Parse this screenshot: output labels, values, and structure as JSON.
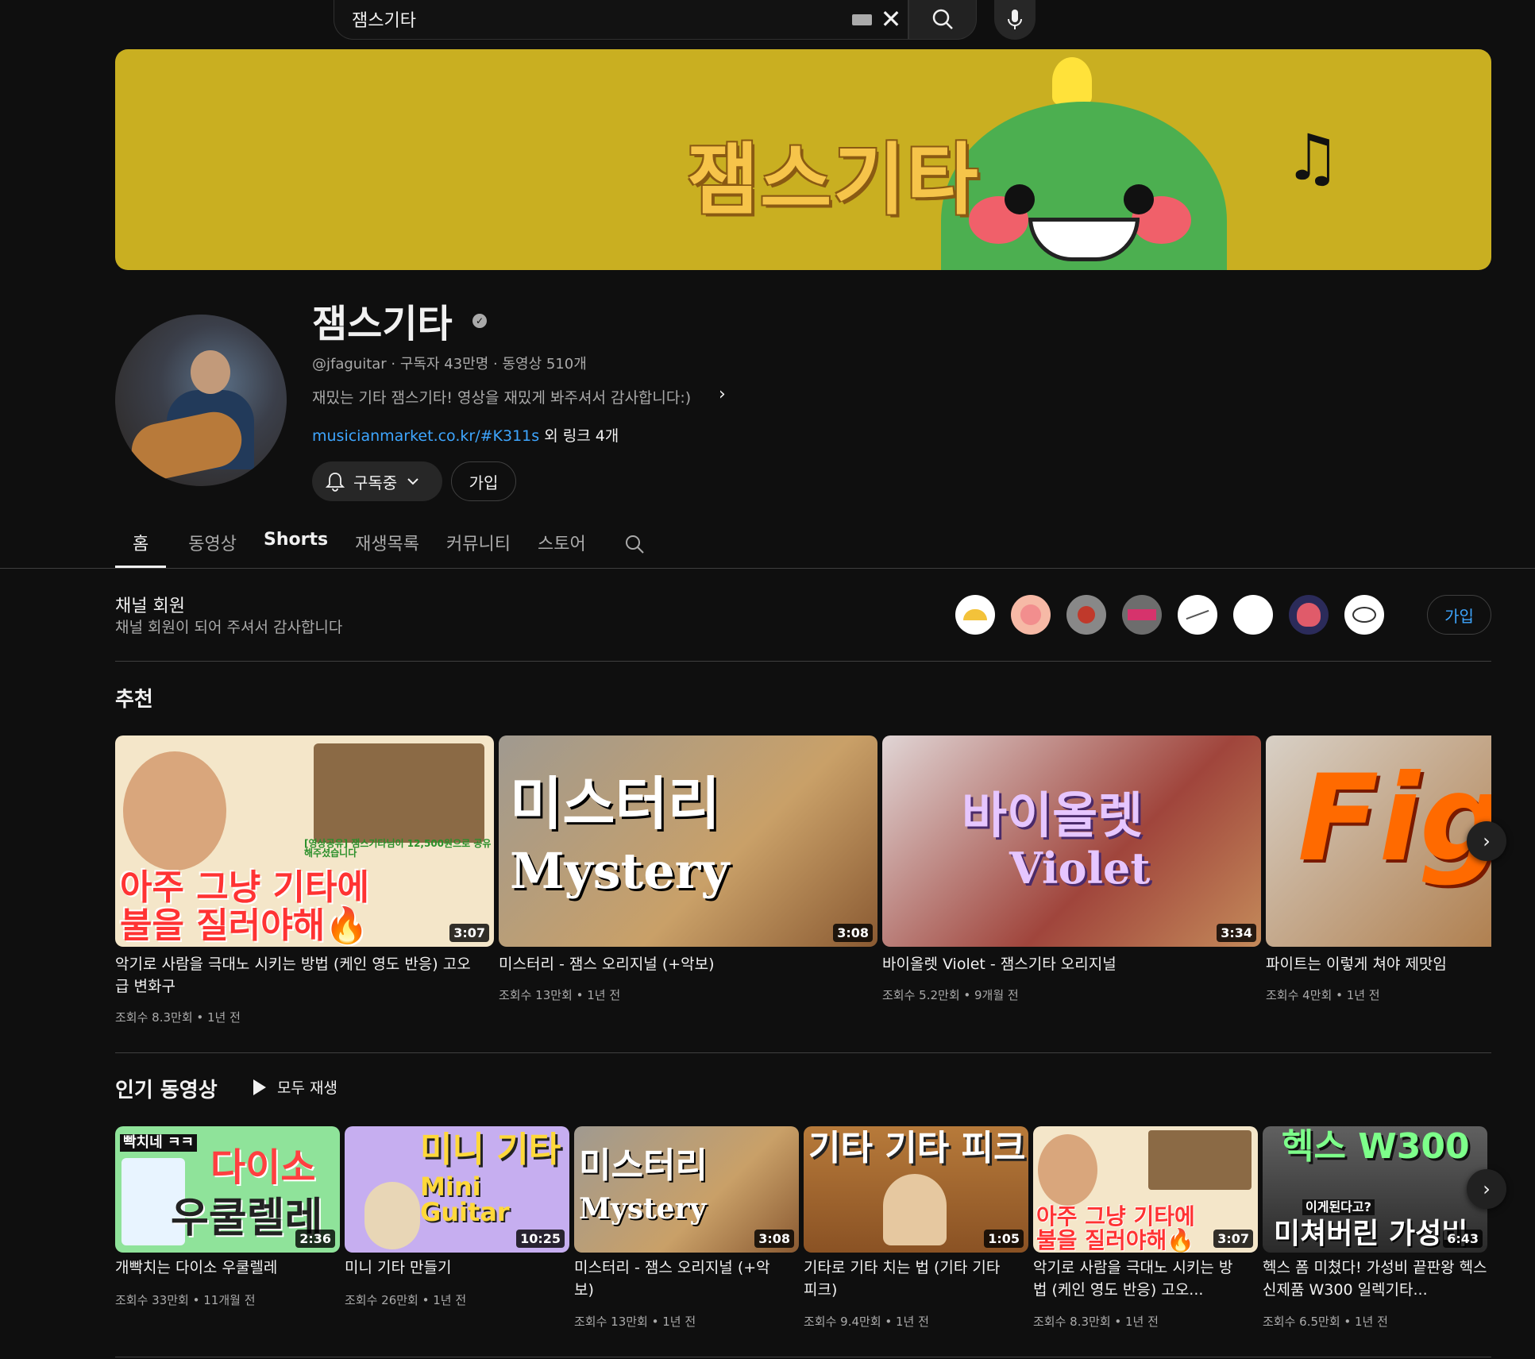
{
  "search": {
    "value": "잼스기타"
  },
  "banner": {
    "title": "잼스기타"
  },
  "channel": {
    "name": "잼스기타",
    "handle_stats": "@jfaguitar · 구독자 43만명 · 동영상 510개",
    "description": "재밌는 기타 잼스기타! 영상을 재밌게 봐주셔서 감사합니다:)",
    "link": "musicianmarket.co.kr/#K311s",
    "link_suffix": " 외 링크 4개",
    "subscribed_label": "구독중",
    "join_label": "가입"
  },
  "tabs": [
    {
      "label": "홈"
    },
    {
      "label": "동영상"
    },
    {
      "label": "Shorts"
    },
    {
      "label": "재생목록"
    },
    {
      "label": "커뮤니티"
    },
    {
      "label": "스토어"
    }
  ],
  "members": {
    "title": "채널 회원",
    "subtitle": "채널 회원이 되어 주셔서 감사합니다",
    "join_label": "가입"
  },
  "recommended": {
    "title": "추천",
    "videos": [
      {
        "thumb_line1": "아주 그냥 기타에",
        "thumb_line2": "불을 질러야해🔥",
        "thumb_note": "[영상공유] 잼스기타님이 12,500원으로 공유 해주셨습니다",
        "duration": "3:07",
        "title": "악기로 사람을 극대노 시키는 방법 (케인 영도 반응) 고오급 변화구",
        "meta": "조회수 8.3만회 • 1년 전"
      },
      {
        "thumb_line1": "미스터리",
        "thumb_line2": "Mystery",
        "duration": "3:08",
        "title": "미스터리 - 잼스 오리지널 (+악보)",
        "meta": "조회수 13만회 • 1년 전"
      },
      {
        "thumb_line1": "바이올렛",
        "thumb_line2": "Violet",
        "duration": "3:34",
        "title": "바이올렛 Violet - 잼스기타 오리지널",
        "meta": "조회수 5.2만회 • 9개월 전"
      },
      {
        "thumb_line1": "Fig",
        "duration": "",
        "title": "파이트는 이렇게 쳐야 제맛임",
        "meta": "조회수 4만회 • 1년 전"
      }
    ]
  },
  "popular": {
    "title": "인기 동영상",
    "play_all": "모두 재생",
    "videos": [
      {
        "thumb_line1": "빡치네 ㅋㅋ",
        "thumb_line2": "다이소",
        "thumb_line3": "우쿨렐레",
        "duration": "2:36",
        "title": "개빡치는 다이소 우쿨렐레",
        "meta": "조회수 33만회 • 11개월 전"
      },
      {
        "thumb_line1": "미니 기타",
        "thumb_line2": "Mini Guitar",
        "duration": "10:25",
        "title": "미니 기타 만들기",
        "meta": "조회수 26만회 • 1년 전"
      },
      {
        "thumb_line1": "미스터리",
        "thumb_line2": "Mystery",
        "duration": "3:08",
        "title": "미스터리 - 잼스 오리지널 (+악보)",
        "meta": "조회수 13만회 • 1년 전"
      },
      {
        "thumb_line1": "기타 기타 피크",
        "duration": "1:05",
        "title": "기타로 기타 치는 법 (기타 기타 피크)",
        "meta": "조회수 9.4만회 • 1년 전"
      },
      {
        "thumb_line1": "아주 그냥 기타에",
        "thumb_line2": "불을 질러야해🔥",
        "duration": "3:07",
        "title": "악기로 사람을 극대노 시키는 방법 (케인 영도 반응) 고오...",
        "meta": "조회수 8.3만회 • 1년 전"
      },
      {
        "thumb_line1": "헥스 W300",
        "thumb_line2": "이게된다고?",
        "thumb_line3": "미쳐버린 가성비",
        "duration": "6:43",
        "title": "헥스 폼 미쳤다! 가성비 끝판왕 헥스 신제품 W300 일렉기타...",
        "meta": "조회수 6.5만회 • 1년 전"
      }
    ]
  },
  "colors": {
    "background": "#0f0f0f",
    "banner": "#c9af21",
    "link": "#3ea6ff",
    "muted": "#aaaaaa"
  }
}
